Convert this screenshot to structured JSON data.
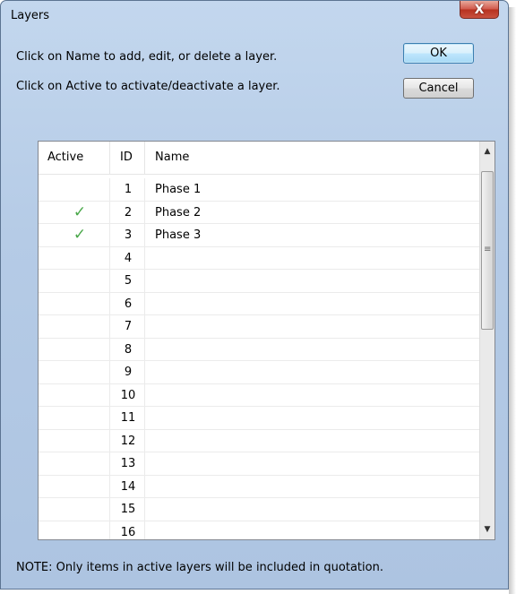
{
  "window": {
    "title": "Layers",
    "close_label": "X"
  },
  "instructions": {
    "line1": "Click on Name to add, edit, or delete a layer.",
    "line2": "Click on Active to activate/deactivate a layer."
  },
  "buttons": {
    "ok": "OK",
    "cancel": "Cancel"
  },
  "table": {
    "columns": [
      "Active",
      "ID",
      "Name"
    ],
    "rows": [
      {
        "active": "",
        "id": "1",
        "name": "Phase 1"
      },
      {
        "active": "✓",
        "id": "2",
        "name": "Phase 2"
      },
      {
        "active": "✓",
        "id": "3",
        "name": "Phase 3"
      },
      {
        "active": "",
        "id": "4",
        "name": ""
      },
      {
        "active": "",
        "id": "5",
        "name": ""
      },
      {
        "active": "",
        "id": "6",
        "name": ""
      },
      {
        "active": "",
        "id": "7",
        "name": ""
      },
      {
        "active": "",
        "id": "8",
        "name": ""
      },
      {
        "active": "",
        "id": "9",
        "name": ""
      },
      {
        "active": "",
        "id": "10",
        "name": ""
      },
      {
        "active": "",
        "id": "11",
        "name": ""
      },
      {
        "active": "",
        "id": "12",
        "name": ""
      },
      {
        "active": "",
        "id": "13",
        "name": ""
      },
      {
        "active": "",
        "id": "14",
        "name": ""
      },
      {
        "active": "",
        "id": "15",
        "name": ""
      },
      {
        "active": "",
        "id": "16",
        "name": ""
      }
    ]
  },
  "scrollbar": {
    "up_icon": "chevron-up-icon",
    "down_icon": "chevron-down-icon",
    "grip": "≡"
  },
  "note": "NOTE:  Only items in active layers will be included in quotation.",
  "colors": {
    "check": "#4aa84a",
    "ok_border": "#3c7fb1",
    "close_red": "#c9513f"
  }
}
